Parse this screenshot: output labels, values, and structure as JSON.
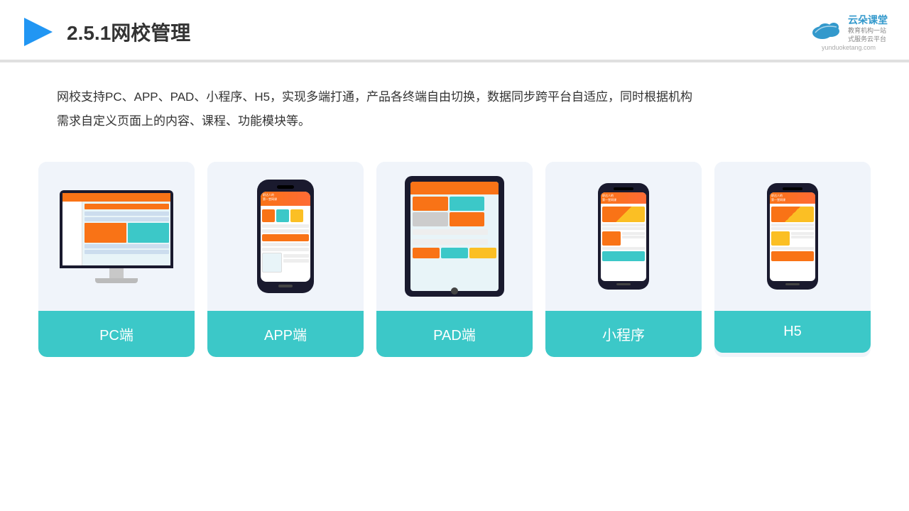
{
  "header": {
    "title": "2.5.1网校管理",
    "logo_name": "云朵课堂",
    "logo_sub1": "教育机构一站",
    "logo_sub2": "式服务云平台",
    "logo_url": "yunduoketang.com"
  },
  "description": {
    "text1": "网校支持PC、APP、PAD、小程序、H5，实现多端打通，产品各终端自由切换，数据同步跨平台自适应，同时根据机构",
    "text2": "需求自定义页面上的内容、课程、功能模块等。"
  },
  "cards": [
    {
      "id": "pc",
      "label": "PC端"
    },
    {
      "id": "app",
      "label": "APP端"
    },
    {
      "id": "pad",
      "label": "PAD端"
    },
    {
      "id": "miniprogram",
      "label": "小程序"
    },
    {
      "id": "h5",
      "label": "H5"
    }
  ],
  "colors": {
    "accent": "#3cc8c8",
    "orange": "#f97316",
    "bg_card": "#f0f4fa",
    "dark": "#1a1a2e"
  }
}
